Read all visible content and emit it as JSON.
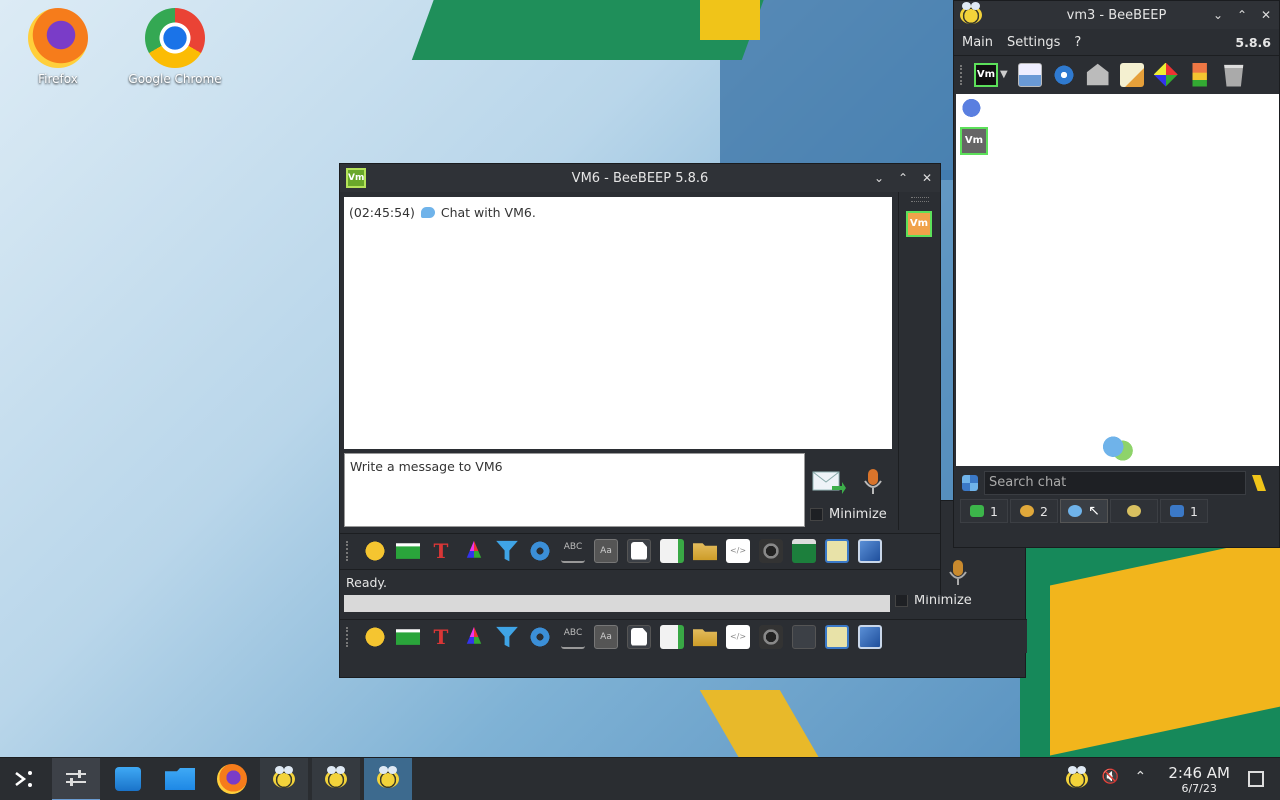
{
  "desktop": {
    "icons": [
      {
        "label": "Firefox"
      },
      {
        "label": "Google Chrome"
      }
    ]
  },
  "chat_window": {
    "title": "VM6 - BeeBEEP 5.8.6",
    "app_badge": "Vm",
    "message": {
      "time": "(02:45:54)",
      "text": "Chat with VM6."
    },
    "input_placeholder": "Write a message to VM6",
    "minimize_label": "Minimize",
    "status": "Ready.",
    "user_badge": "Vm"
  },
  "back_window": {
    "minimize_label": "Minimize"
  },
  "main_window": {
    "title": "vm3 - BeeBEEP",
    "menu": [
      "Main",
      "Settings",
      "?"
    ],
    "version": "5.8.6",
    "vm_badge": "Vm",
    "user_badge": "Vm",
    "search_placeholder": "Search chat",
    "tabs": [
      {
        "count": "1",
        "color": "#3cb54a"
      },
      {
        "count": "2",
        "color": "#e0a83a"
      },
      {
        "count": "",
        "color": "#6fb3ea"
      },
      {
        "count": "",
        "color": "#d8c060"
      },
      {
        "count": "1",
        "color": "#3b79c7"
      }
    ]
  },
  "taskbar": {
    "clock_time": "2:46 AM",
    "clock_date": "6/7/23"
  }
}
